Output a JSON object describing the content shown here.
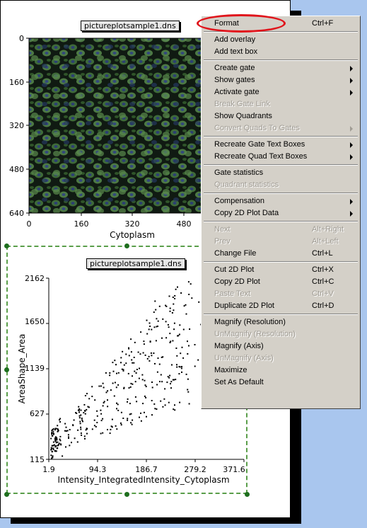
{
  "plot1": {
    "title": "pictureplotsample1.dns",
    "x_ticks": [
      "0",
      "160",
      "320",
      "480"
    ],
    "y_ticks": [
      "0",
      "160",
      "320",
      "480",
      "640"
    ],
    "x_label": "Cytoplasm"
  },
  "plot2": {
    "title": "pictureplotsample1.dns",
    "x_ticks": [
      "1.9",
      "94.3",
      "186.7",
      "279.2",
      "371.6"
    ],
    "y_ticks": [
      "2162",
      "1650",
      "1139",
      "627",
      "115"
    ],
    "x_label": "Intensity_IntegratedIntensity_Cytoplasm",
    "y_label": "AreaShape_Area"
  },
  "menu": {
    "items": [
      {
        "label": "Format",
        "shortcut": "Ctrl+F",
        "enabled": true,
        "submenu": false
      },
      {
        "sep": true
      },
      {
        "label": "Add overlay",
        "enabled": true,
        "submenu": false
      },
      {
        "label": "Add text box",
        "enabled": true,
        "submenu": false
      },
      {
        "sep": true
      },
      {
        "label": "Create gate",
        "enabled": true,
        "submenu": true
      },
      {
        "label": "Show gates",
        "enabled": true,
        "submenu": true
      },
      {
        "label": "Activate gate",
        "enabled": true,
        "submenu": true
      },
      {
        "label": "Break Gate Link",
        "enabled": false,
        "submenu": false
      },
      {
        "label": "Show Quadrants",
        "enabled": true,
        "submenu": false
      },
      {
        "label": "Convert Quads To Gates",
        "enabled": false,
        "submenu": true
      },
      {
        "sep": true
      },
      {
        "label": "Recreate Gate Text Boxes",
        "enabled": true,
        "submenu": true
      },
      {
        "label": "Recreate Quad Text Boxes",
        "enabled": true,
        "submenu": true
      },
      {
        "sep": true
      },
      {
        "label": "Gate statistics",
        "enabled": true,
        "submenu": false
      },
      {
        "label": "Quadrant statistics",
        "enabled": false,
        "submenu": false
      },
      {
        "sep": true
      },
      {
        "label": "Compensation",
        "enabled": true,
        "submenu": true
      },
      {
        "label": "Copy 2D Plot Data",
        "enabled": true,
        "submenu": true
      },
      {
        "sep": true
      },
      {
        "label": "Next",
        "shortcut": "Alt+Right",
        "enabled": false,
        "submenu": false
      },
      {
        "label": "Prev",
        "shortcut": "Alt+Left",
        "enabled": false,
        "submenu": false
      },
      {
        "label": "Change File",
        "shortcut": "Ctrl+L",
        "enabled": true,
        "submenu": false
      },
      {
        "sep": true
      },
      {
        "label": "Cut 2D Plot",
        "shortcut": "Ctrl+X",
        "enabled": true,
        "submenu": false
      },
      {
        "label": "Copy 2D Plot",
        "shortcut": "Ctrl+C",
        "enabled": true,
        "submenu": false
      },
      {
        "label": "Paste Text",
        "shortcut": "Ctrl+V",
        "enabled": false,
        "submenu": false
      },
      {
        "label": "Duplicate 2D Plot",
        "shortcut": "Ctrl+D",
        "enabled": true,
        "submenu": false
      },
      {
        "sep": true
      },
      {
        "label": "Magnify (Resolution)",
        "enabled": true,
        "submenu": false
      },
      {
        "label": "UnMagnify (Resolution)",
        "enabled": false,
        "submenu": false
      },
      {
        "label": "Magnify (Axis)",
        "enabled": true,
        "submenu": false
      },
      {
        "label": "UnMagnify (Axis)",
        "enabled": false,
        "submenu": false
      },
      {
        "label": "Maximize",
        "enabled": true,
        "submenu": false
      },
      {
        "label": "Set As Default",
        "enabled": true,
        "submenu": false
      }
    ]
  },
  "colors": {
    "desktop": "#a9c6ee",
    "menu_bg": "#d4d0c8",
    "highlight_ring": "#e0141b",
    "selection_handle": "#1e6e1e"
  }
}
